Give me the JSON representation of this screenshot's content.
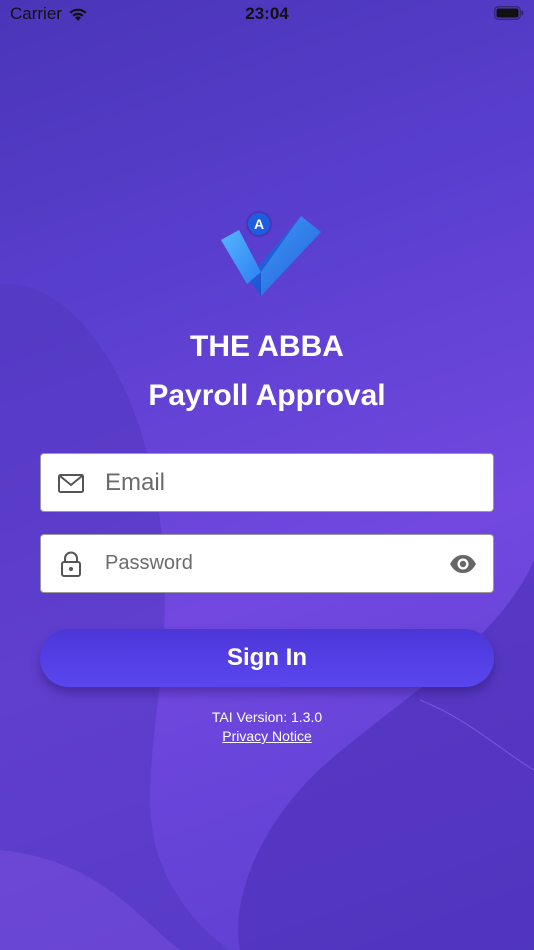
{
  "status_bar": {
    "carrier": "Carrier",
    "time": "23:04",
    "icons": [
      "wifi-icon",
      "battery-icon"
    ]
  },
  "logo": {
    "badge_letter": "A",
    "icon": "checkmark-logo-icon",
    "colors": {
      "check_light": "#46a8f5",
      "check_dark": "#1a56d6",
      "badge": "#1f5de0"
    }
  },
  "header": {
    "line1": "THE ABBA",
    "line2": "Payroll Approval"
  },
  "form": {
    "email": {
      "placeholder": "Email",
      "value": "",
      "icon": "mail-icon"
    },
    "password": {
      "placeholder": "Password",
      "value": "",
      "icon": "lock-icon",
      "toggle_icon": "eye-icon"
    },
    "sign_in_label": "Sign In"
  },
  "footer": {
    "version": "TAI Version: 1.3.0",
    "privacy": "Privacy Notice"
  },
  "theme": {
    "background_primary": "#5a3fcf",
    "button": "#4f3ce0"
  }
}
